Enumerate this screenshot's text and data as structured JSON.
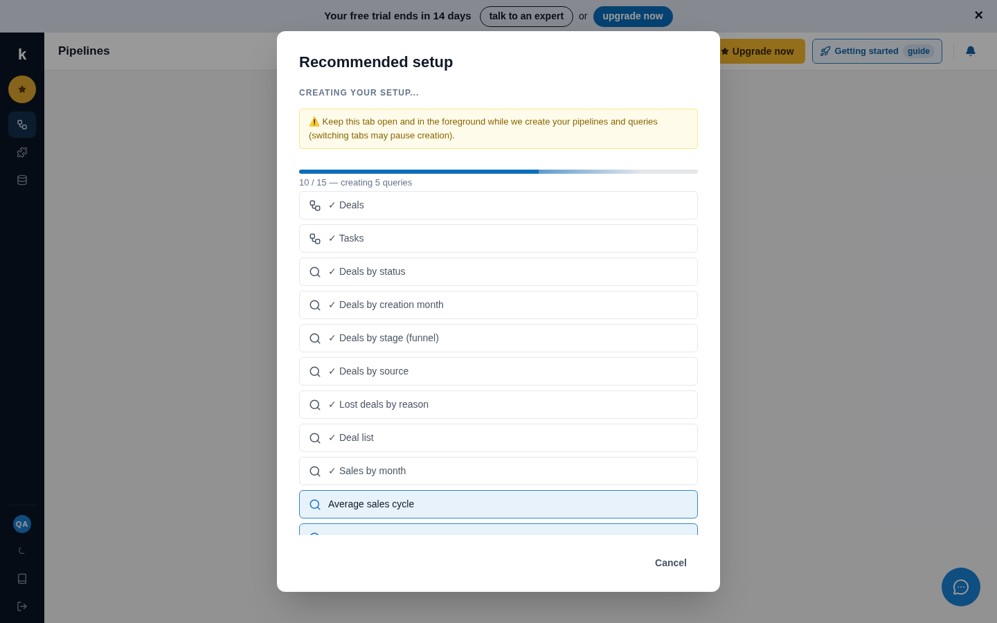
{
  "banner": {
    "text": "Your free trial ends in 14 days",
    "expert_button": "talk to an expert",
    "or": "or",
    "upgrade_button": "upgrade now",
    "close": "×"
  },
  "sidebar": {
    "logo": "k",
    "items": [
      {
        "kind": "pipelines",
        "selected": true
      },
      {
        "kind": "integrations",
        "selected": false
      },
      {
        "kind": "data",
        "selected": false
      }
    ],
    "avatar": "QA"
  },
  "header": {
    "title": "Pipelines",
    "upgrade_button": "Upgrade now",
    "guide_button": "Getting started",
    "guide_badge": "guide"
  },
  "dialog": {
    "title": "Recommended setup",
    "subtitle": "CREATING YOUR SETUP...",
    "warning": "⚠️ Keep this tab open and in the foreground while we create your pipelines and queries (switching tabs may pause creation).",
    "progress": {
      "level": 0.6,
      "label": "10 / 15 — creating 5 queries"
    },
    "items": [
      {
        "kind": "pipeline",
        "done": true,
        "label": "✓ Deals"
      },
      {
        "kind": "pipeline",
        "done": true,
        "label": "✓ Tasks"
      },
      {
        "kind": "query",
        "done": true,
        "label": "✓ Deals by status"
      },
      {
        "kind": "query",
        "done": true,
        "label": "✓ Deals by creation month"
      },
      {
        "kind": "query",
        "done": true,
        "label": "✓ Deals by stage (funnel)"
      },
      {
        "kind": "query",
        "done": true,
        "label": "✓ Deals by source"
      },
      {
        "kind": "query",
        "done": true,
        "label": "✓ Lost deals by reason"
      },
      {
        "kind": "query",
        "done": true,
        "label": "✓ Deal list"
      },
      {
        "kind": "query",
        "done": true,
        "label": "✓ Sales by month"
      },
      {
        "kind": "query",
        "done": false,
        "label": "Average sales cycle"
      },
      {
        "kind": "query",
        "done": false
      }
    ],
    "cancel_button": "Cancel"
  }
}
